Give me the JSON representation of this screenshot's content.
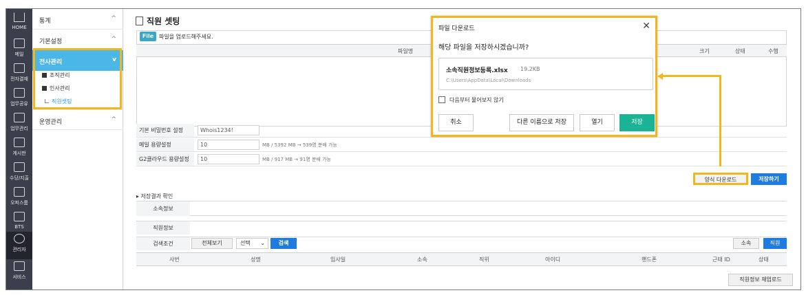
{
  "rail": [
    {
      "label": "HOME",
      "icon": "home-icon"
    },
    {
      "label": "메일",
      "icon": "mail-icon"
    },
    {
      "label": "전자결재",
      "icon": "monitor-icon"
    },
    {
      "label": "업무공유",
      "icon": "share-doc-icon"
    },
    {
      "label": "업무관리",
      "icon": "task-doc-icon"
    },
    {
      "label": "게시판",
      "icon": "chat-icon"
    },
    {
      "label": "수당/지출",
      "icon": "won-icon"
    },
    {
      "label": "오피스룸",
      "icon": "office-icon"
    },
    {
      "label": "BTS",
      "icon": "briefcase-icon"
    },
    {
      "label": "관리자",
      "icon": "admin-gear-icon"
    },
    {
      "label": "서비스",
      "icon": "service-icon"
    }
  ],
  "sidebar": {
    "groups": [
      {
        "label": "통계",
        "chevron": "^"
      },
      {
        "label": "기본설정",
        "chevron": "^"
      },
      {
        "label": "전사관리",
        "chevron": "v"
      },
      {
        "label": "운영관리",
        "chevron": "^"
      }
    ],
    "sub_items": [
      "조직관리",
      "인사관리",
      "직원셋팅"
    ]
  },
  "page": {
    "title": "직원 셋팅"
  },
  "upload": {
    "file_button": "File",
    "message": "파일을 업로드해주세요."
  },
  "file_table": {
    "headers": [
      "파일명",
      "크기",
      "상태",
      "수행"
    ]
  },
  "settings": [
    {
      "label": "기본 비밀번호 설정",
      "value": "Whois1234!",
      "note": ""
    },
    {
      "label": "메일 용량설정",
      "value": "10",
      "note": "MB / 5392 MB  →  539명 분배 가능"
    },
    {
      "label": "G2클라우드 용량설정",
      "value": "10",
      "note": "MB / 917 MB  →  91명 분배 가능"
    }
  ],
  "actions": {
    "download_form": "양식 다운로드",
    "save": "저장하기"
  },
  "result": {
    "section_title": "▸ 저장결과 확인",
    "belong_label": "소속정보",
    "employee_label": "직원정보",
    "search_label": "검색조건",
    "view_all": "전체보기",
    "select_placeholder": "선택",
    "search_button": "검색",
    "filter_belong": "소속",
    "filter_employee": "직원",
    "columns": [
      "사번",
      "성명",
      "입사일",
      "소속",
      "직위",
      "아이디",
      "핸드폰",
      "근태 ID",
      "상태"
    ],
    "reupload": "직원정보 재업로드"
  },
  "dialog": {
    "title": "파일 다운로드",
    "question": "해당 파일을 저장하시겠습니까?",
    "file_name": "소속직원정보등록.xlsx",
    "file_size": "19.2KB",
    "file_path": "C:\\Users\\AppData\\Local\\Downloads",
    "dont_ask": "다음부터 물어보지 않기",
    "cancel": "취소",
    "save_as": "다른 이름으로 저장",
    "open": "열기",
    "save": "저장"
  },
  "colors": {
    "accent": "#4bb7e6",
    "highlight": "#f2b81b",
    "primary": "#1f7be0",
    "save_green": "#1bb395",
    "rail_bg": "#3a3f4b"
  }
}
